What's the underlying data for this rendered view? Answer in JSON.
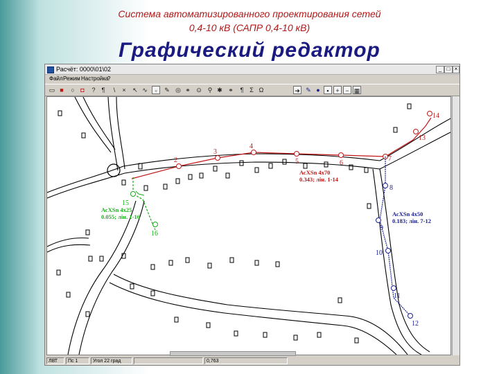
{
  "slide": {
    "title_line1": "Система автоматизированного проектирования сетей\n0,4-10 кВ  (САПР 0,4-10 кВ)",
    "title_line2": "Графический редактор"
  },
  "window": {
    "title": "Расчёт: 0000\\01\\02",
    "menu": [
      "Файл",
      "Режим",
      "Настройка",
      "?"
    ],
    "statusbar": [
      "ЛВТ",
      "Пс 1",
      "Угол 22 град",
      "",
      "0,763"
    ]
  },
  "colors": {
    "red_network": "#c01818",
    "blue_network": "#1a2090",
    "green_network": "#18b018",
    "roads": "#000000"
  },
  "map": {
    "red_nodes": [
      {
        "label": "2"
      },
      {
        "label": "3"
      },
      {
        "label": "4"
      },
      {
        "label": "5"
      },
      {
        "label": "6"
      },
      {
        "label": "7"
      },
      {
        "label": "13"
      },
      {
        "label": "14"
      }
    ],
    "blue_nodes": [
      {
        "label": "8"
      },
      {
        "label": "9"
      },
      {
        "label": "10"
      },
      {
        "label": "11"
      },
      {
        "label": "12"
      }
    ],
    "green_nodes": [
      {
        "label": "15"
      },
      {
        "label": "16"
      }
    ],
    "cable_labels": [
      {
        "line1": "АсХSn 4х70",
        "line2": "0.343; лін. 1-14",
        "color": "red"
      },
      {
        "line1": "АсХSn 4х50",
        "line2": "0.183; лін. 7-12",
        "color": "blue"
      },
      {
        "line1": "АсХSn 4х25",
        "line2": "0.055; лін. 1-16",
        "color": "green"
      }
    ]
  }
}
